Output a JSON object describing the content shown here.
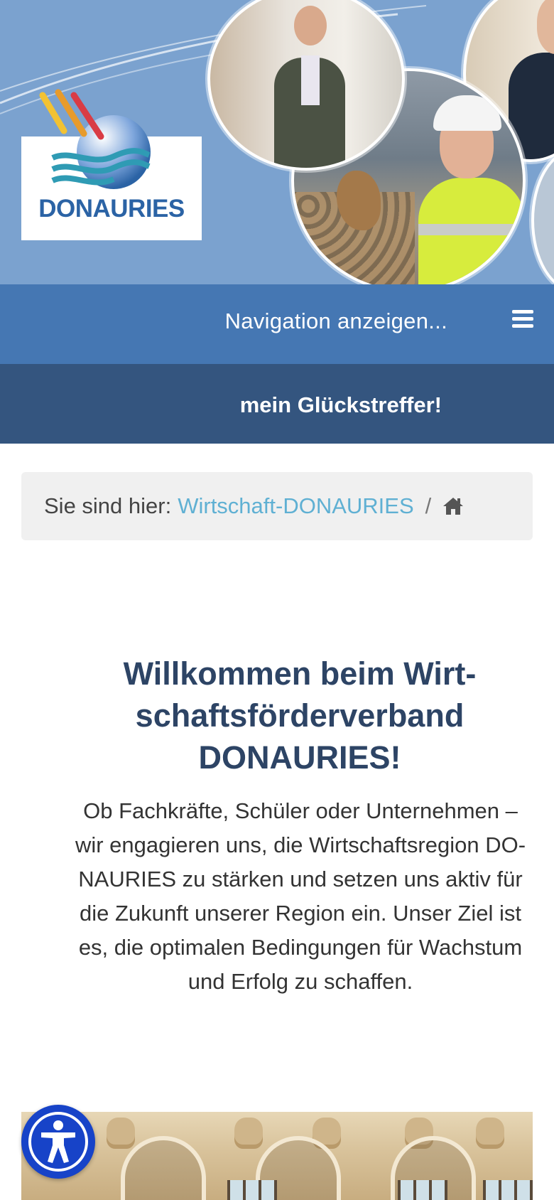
{
  "header": {
    "logo_text": "DONAURIES",
    "colors": {
      "banner": "#7ba2cf",
      "logo_blue": "#2b63a5"
    }
  },
  "nav": {
    "label": "Navigation anzeigen...",
    "menu_icon": "hamburger-icon",
    "color": "#4577b3"
  },
  "slogan": {
    "text": "mein Glückstreffer!",
    "color": "#34557f"
  },
  "breadcrumb": {
    "prefix": "Sie sind hier:",
    "link": "Wirtschaft-DONAURIES",
    "separator": "/",
    "home_icon": "home-icon"
  },
  "content": {
    "headline_lines": [
      "Willkommen beim Wirt-",
      "schaftsförderverband",
      "DONAURIES!"
    ],
    "intro_lines": [
      "Ob Fachkräfte, Schüler oder Unternehmen –",
      "wir engagieren uns, die Wirtschaftsregion DO-",
      "NAURIES zu stärken und setzen uns aktiv für",
      "die Zukunft unserer Region ein. Unser Ziel ist",
      "es, die optimalen Bedingungen für Wachstum",
      "und Erfolg zu schaffen."
    ]
  },
  "accessibility": {
    "icon": "accessibility-icon",
    "color": "#1743c8"
  }
}
